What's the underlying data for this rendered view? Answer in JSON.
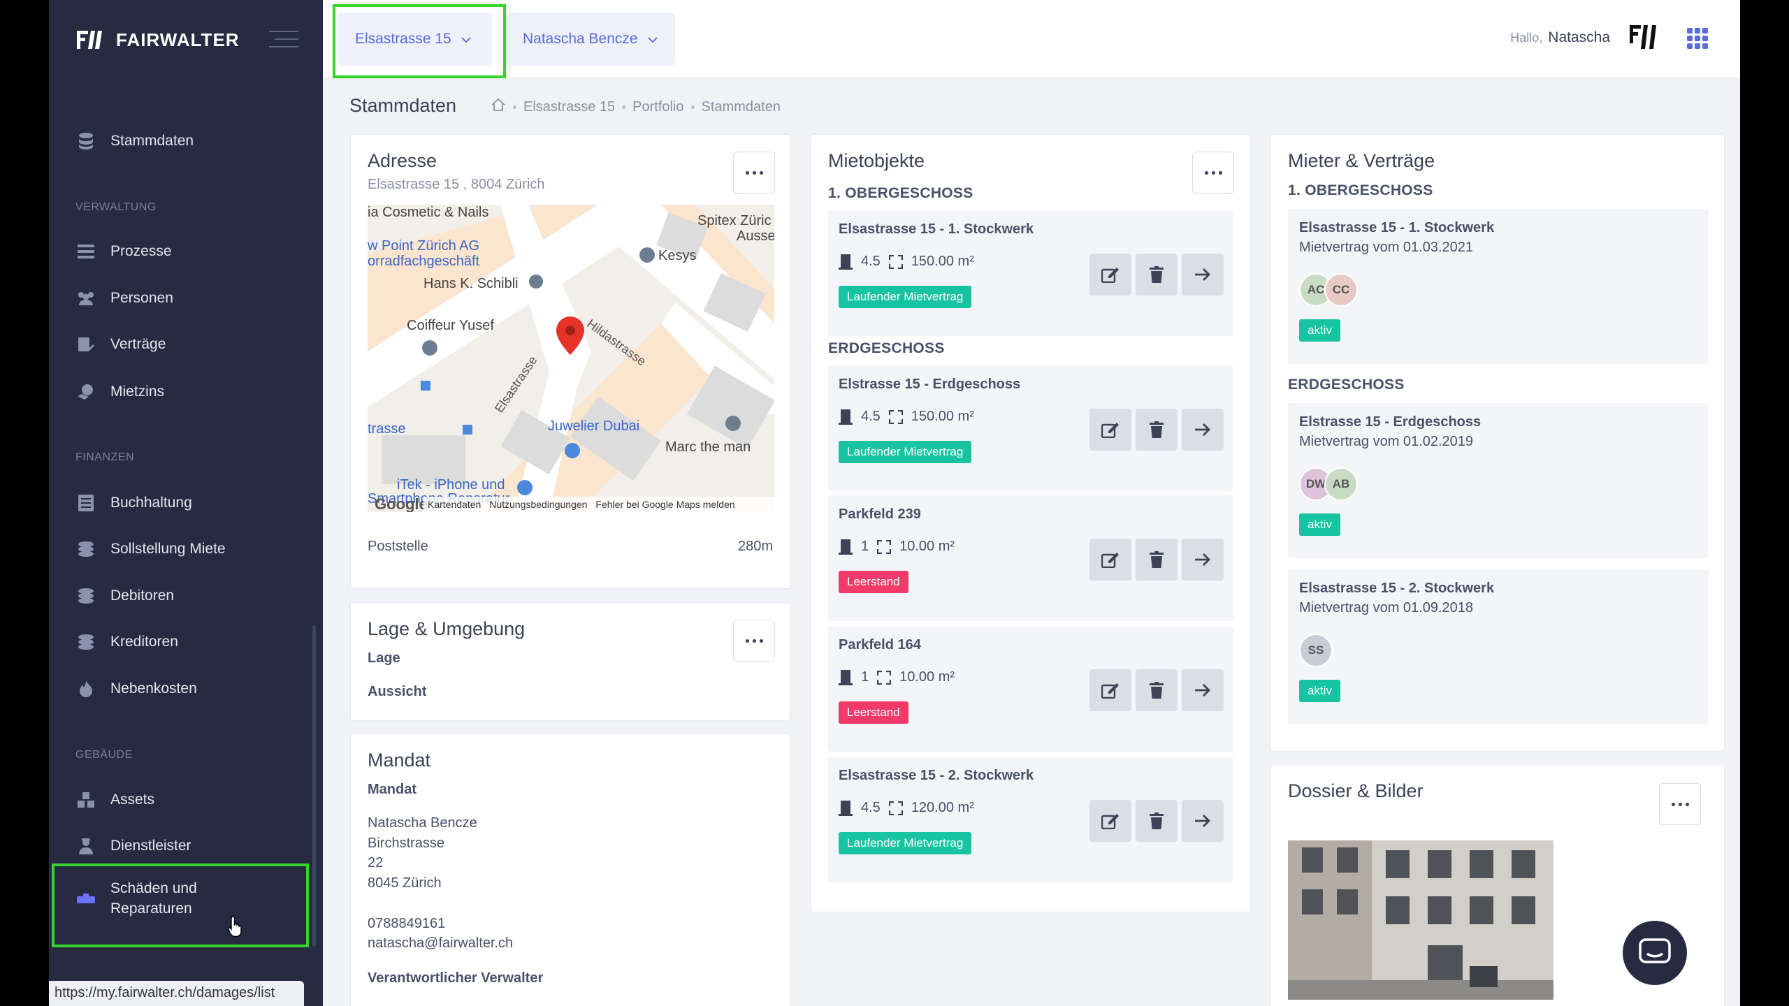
{
  "app": {
    "brand": "FAIRWALTER"
  },
  "sidebar": {
    "items": [
      {
        "label": "Stammdaten"
      },
      {
        "label": "Prozesse"
      },
      {
        "label": "Personen"
      },
      {
        "label": "Verträge"
      },
      {
        "label": "Mietzins"
      },
      {
        "label": "Buchhaltung"
      },
      {
        "label": "Sollstellung Miete"
      },
      {
        "label": "Debitoren"
      },
      {
        "label": "Kreditoren"
      },
      {
        "label": "Nebenkosten"
      },
      {
        "label": "Assets"
      },
      {
        "label": "Dienstleister"
      },
      {
        "label": "Schäden und Reparaturen"
      }
    ],
    "sections": {
      "verwaltung": "VERWALTUNG",
      "finanzen": "FINANZEN",
      "gebaeude": "GEBÄUDE"
    }
  },
  "status_url": "https://my.fairwalter.ch/damages/list",
  "topbar": {
    "property": "Elsastrasse 15",
    "user_select": "Natascha Bencze",
    "greeting": "Hallo,",
    "greeting_name": "Natascha"
  },
  "page": {
    "title": "Stammdaten",
    "breadcrumb": [
      "Elsastrasse 15",
      "Portfolio",
      "Stammdaten"
    ]
  },
  "adresse": {
    "title": "Adresse",
    "subtitle": "Elsastrasse 15 , 8004 Zürich",
    "poi": "Poststelle",
    "distance": "280m",
    "map_labels": {
      "l1": "ia Cosmetic & Nails",
      "l2": "Spitex Züric",
      "l3": "Ausse",
      "l4": "w Point Zürich AG",
      "l5": "orradfachgeschäft",
      "l6": "Kesys",
      "l7": "Hans K. Schibli",
      "l8": "Coiffeur Yusef",
      "l9": "Hildastrasse",
      "l10": "Elsastrasse",
      "l11": "trasse",
      "l12": "Juwelier Dubai",
      "l13": "Marc the man",
      "l14": "iTek - iPhone und",
      "l15": "Smartphone Reparatur",
      "google": "Google",
      "f1": "Kartendaten",
      "f2": "Nutzungsbedingungen",
      "f3": "Fehler bei Google Maps melden"
    }
  },
  "lage": {
    "title": "Lage & Umgebung",
    "lage": "Lage",
    "aussicht": "Aussicht"
  },
  "mandat": {
    "title": "Mandat",
    "label": "Mandat",
    "name": "Natascha Bencze",
    "street": "Birchstrasse",
    "number": "22",
    "city": "8045 Zürich",
    "phone": "0788849161",
    "email": "natascha@fairwalter.ch",
    "verwalter": "Verantwortlicher Verwalter"
  },
  "mietobjekte": {
    "title": "Mietobjekte",
    "sections": [
      "1. OBERGESCHOSS",
      "ERDGESCHOSS"
    ],
    "units": [
      {
        "name": "Elsastrasse 15 - 1. Stockwerk",
        "rooms": "4.5",
        "area": "150.00 m²",
        "status": "Laufender Mietvertrag"
      },
      {
        "name": "Elstrasse 15 - Erdgeschoss",
        "rooms": "4.5",
        "area": "150.00 m²",
        "status": "Laufender Mietvertrag"
      },
      {
        "name": "Parkfeld 239",
        "rooms": "1",
        "area": "10.00 m²",
        "status": "Leerstand"
      },
      {
        "name": "Parkfeld 164",
        "rooms": "1",
        "area": "10.00 m²",
        "status": "Leerstand"
      },
      {
        "name": "Elsastrasse 15 - 2. Stockwerk",
        "rooms": "4.5",
        "area": "120.00 m²",
        "status": "Laufender Mietvertrag"
      }
    ]
  },
  "mieter": {
    "title": "Mieter & Verträge",
    "sections": [
      "1. OBERGESCHOSS",
      "ERDGESCHOSS"
    ],
    "tenants": [
      {
        "name": "Elsastrasse 15 - 1. Stockwerk",
        "contract": "Mietvertrag vom 01.03.2021",
        "avatars": [
          "AC",
          "CC"
        ],
        "status": "aktiv"
      },
      {
        "name": "Elstrasse 15 - Erdgeschoss",
        "contract": "Mietvertrag vom 01.02.2019",
        "avatars": [
          "DW",
          "AB"
        ],
        "status": "aktiv"
      },
      {
        "name": "Elsastrasse 15 - 2. Stockwerk",
        "contract": "Mietvertrag vom 01.09.2018",
        "avatars": [
          "SS"
        ],
        "status": "aktiv"
      }
    ]
  },
  "dossier": {
    "title": "Dossier & Bilder"
  },
  "colors": {
    "sidebar": "#262b41",
    "accent": "#5a6bdc",
    "green": "#17c4a2",
    "red": "#f03a6a",
    "highlight": "#37d22c"
  }
}
